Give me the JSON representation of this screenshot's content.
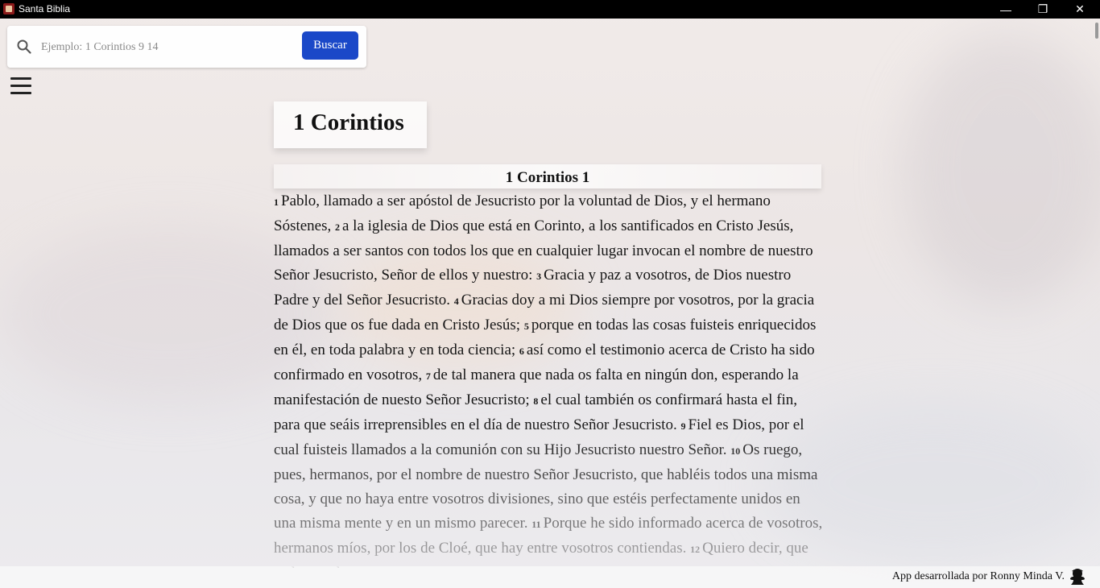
{
  "window": {
    "title": "Santa Biblia",
    "minimize": "—",
    "maximize": "❐",
    "close": "✕"
  },
  "search": {
    "placeholder": "Ejemplo: 1 Corintios 9 14",
    "button_label": "Buscar"
  },
  "book": {
    "title": "1 Corintios",
    "chapter_title": "1 Corintios 1"
  },
  "verses": [
    {
      "num": "1",
      "text": "Pablo, llamado a ser apóstol de Jesucristo por la voluntad de Dios, y el hermano Sóstenes,"
    },
    {
      "num": "2",
      "text": "a la iglesia de Dios que está en Corinto, a los santificados en Cristo Jesús, llamados a ser santos con todos los que en cualquier lugar invocan el nombre de nuestro Señor Jesucristo, Señor de ellos y nuestro:"
    },
    {
      "num": "3",
      "text": "Gracia y paz a vosotros, de Dios nuestro Padre y del Señor Jesucristo."
    },
    {
      "num": "4",
      "text": "Gracias doy a mi Dios siempre por vosotros, por la gracia de Dios que os fue dada en Cristo Jesús;"
    },
    {
      "num": "5",
      "text": "porque en todas las cosas fuisteis enriquecidos en él, en toda palabra y en toda ciencia;"
    },
    {
      "num": "6",
      "text": "así como el testimonio acerca de Cristo ha sido confirmado en vosotros,"
    },
    {
      "num": "7",
      "text": "de tal manera que nada os falta en ningún don, esperando la manifestación de nuesto Señor Jesucristo;"
    },
    {
      "num": "8",
      "text": "el cual también os confirmará hasta el fin, para que seáis irreprensibles en el día de nuestro Señor Jesucristo."
    },
    {
      "num": "9",
      "text": "Fiel es Dios, por el cual fuisteis llamados a la comunión con su Hijo Jesucristo nuestro Señor."
    },
    {
      "num": "10",
      "text": "Os ruego, pues, hermanos, por el nombre de nuestro Señor Jesucristo, que habléis todos una misma cosa, y que no haya entre vosotros divisiones, sino que estéis perfectamente unidos en una misma mente y en un mismo parecer."
    },
    {
      "num": "11",
      "text": "Porque he sido informado acerca de vosotros, hermanos míos, por los de Cloé, que hay entre vosotros contiendas."
    },
    {
      "num": "12",
      "text": "Quiero decir, que cada uno de"
    }
  ],
  "footer": {
    "credit": "App desarrollada por Ronny Minda V."
  }
}
